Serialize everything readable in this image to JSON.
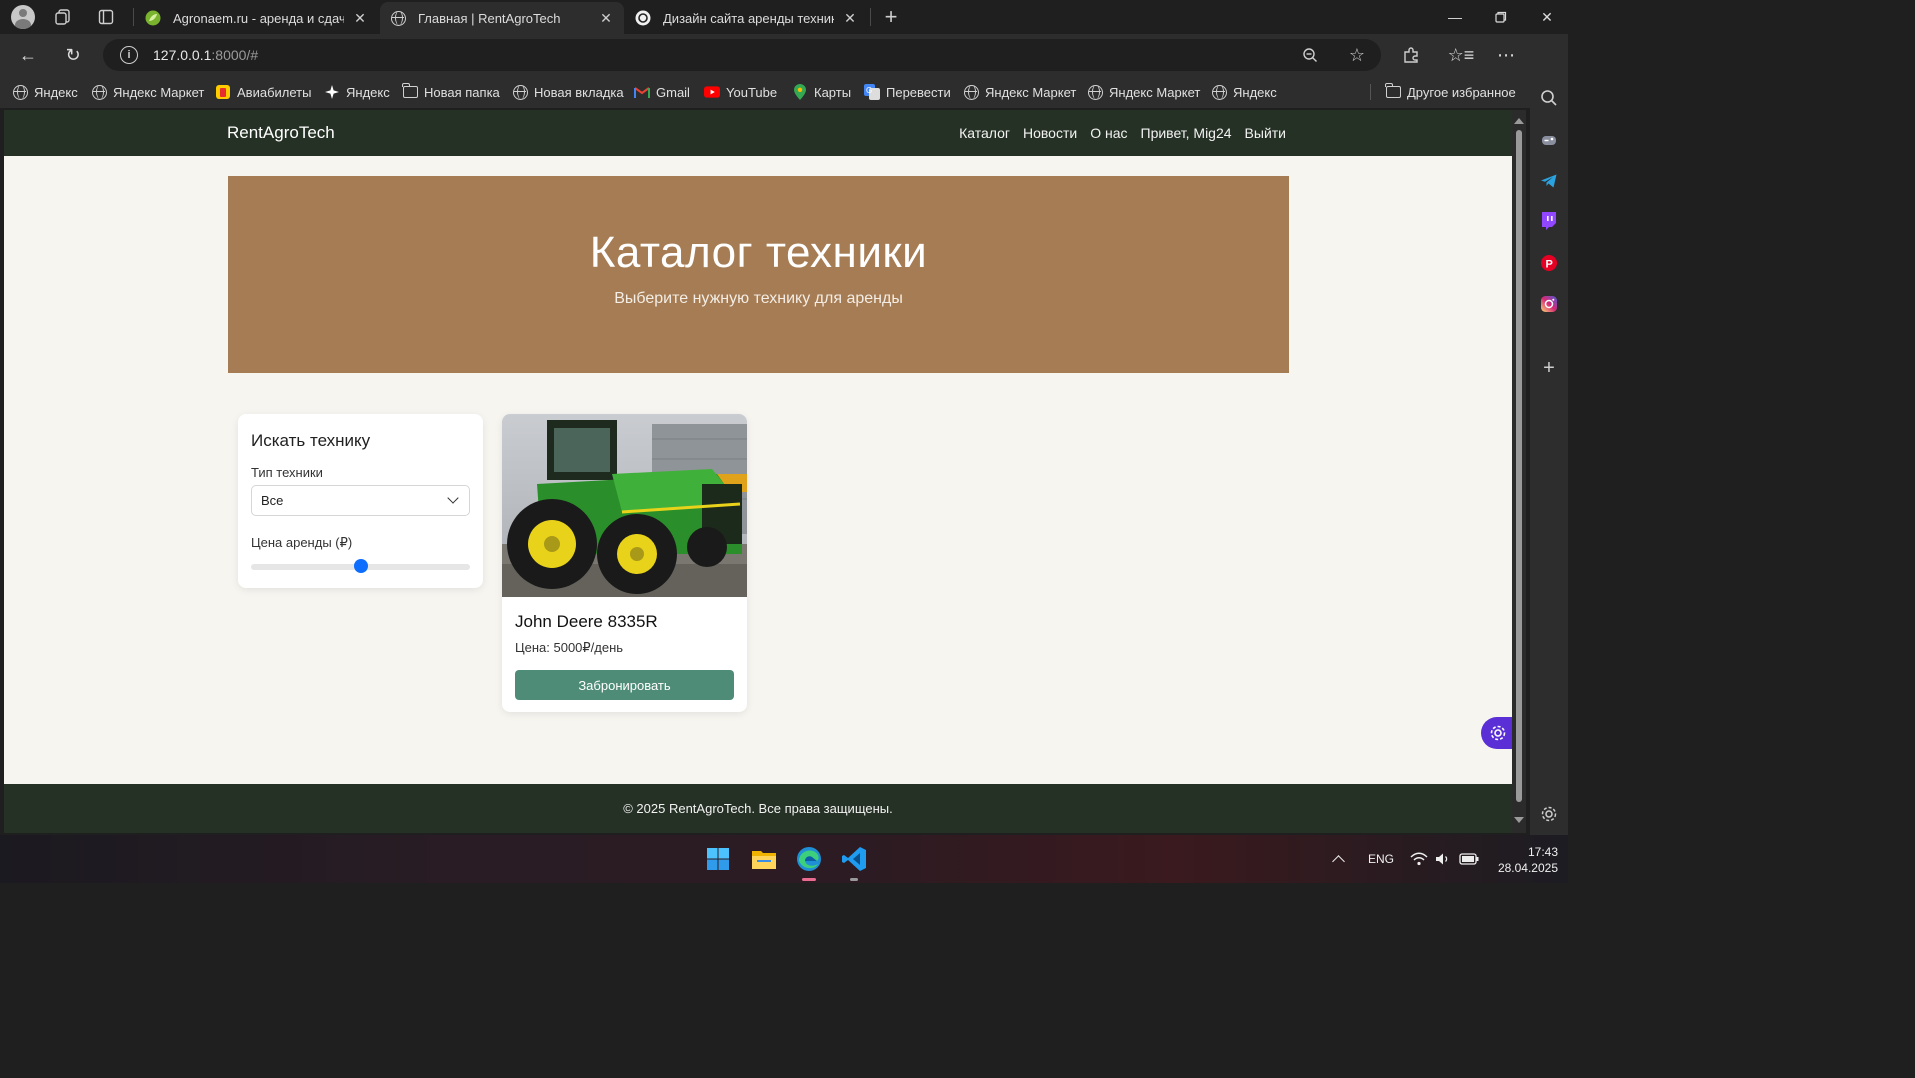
{
  "browser": {
    "tabs": [
      {
        "title": "Agronaem.ru - аренда и сдача в",
        "active": false
      },
      {
        "title": "Главная | RentAgroTech",
        "active": true
      },
      {
        "title": "Дизайн сайта аренды техники",
        "active": false
      }
    ],
    "address": {
      "host": "127.0.0.1",
      "rest": ":8000/#"
    },
    "bookmarks": [
      {
        "label": "Яндекс",
        "icon": "globe-icon"
      },
      {
        "label": "Яндекс Маркет",
        "icon": "globe-icon"
      },
      {
        "label": "Авиабилеты",
        "icon": "flights-icon"
      },
      {
        "label": "Яндекс",
        "icon": "sparkle-icon"
      },
      {
        "label": "Новая папка",
        "icon": "folder-icon"
      },
      {
        "label": "Новая вкладка",
        "icon": "globe-icon"
      },
      {
        "label": "Gmail",
        "icon": "gmail-icon"
      },
      {
        "label": "YouTube",
        "icon": "youtube-icon"
      },
      {
        "label": "Карты",
        "icon": "maps-icon"
      },
      {
        "label": "Перевести",
        "icon": "translate-icon"
      },
      {
        "label": "Яндекс Маркет",
        "icon": "globe-icon"
      },
      {
        "label": "Яндекс Маркет",
        "icon": "globe-icon"
      },
      {
        "label": "Яндекс",
        "icon": "globe-icon"
      }
    ],
    "other_bookmarks": "Другое избранное"
  },
  "site": {
    "brand": "RentAgroTech",
    "nav": [
      "Каталог",
      "Новости",
      "О нас",
      "Привет, Mig24",
      "Выйти"
    ],
    "hero": {
      "title": "Каталог техники",
      "subtitle": "Выберите нужную технику для аренды"
    },
    "filter": {
      "title": "Искать технику",
      "type_label": "Тип техники",
      "type_value": "Все",
      "price_label": "Цена аренды (₽)",
      "price_slider_fraction": 0.5
    },
    "products": [
      {
        "name": "John Deere 8335R",
        "price": "Цена: 5000₽/день",
        "button": "Забронировать"
      }
    ],
    "footer": "© 2025 RentAgroTech. Все права защищены."
  },
  "taskbar": {
    "language": "ENG",
    "time": "17:43",
    "date": "28.04.2025"
  }
}
